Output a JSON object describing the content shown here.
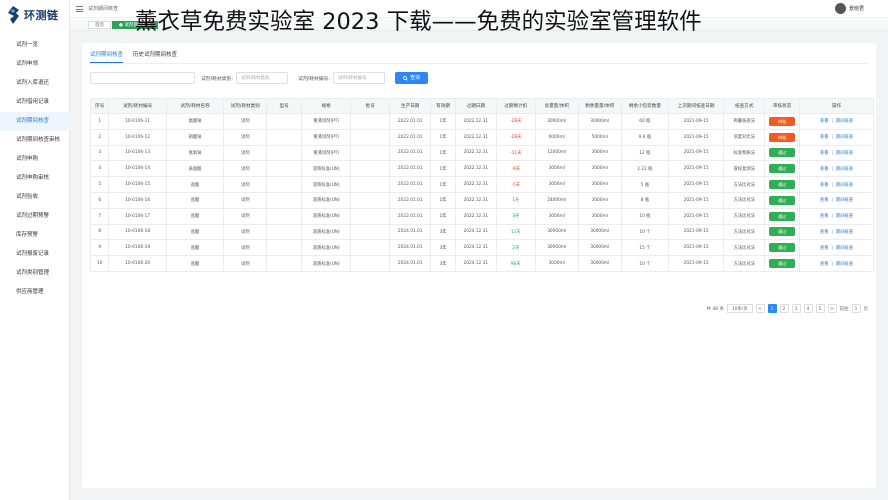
{
  "overlay_title": "薰衣草免费实验室 2023 下载——免费的实验室管理软件",
  "brand": {
    "name": "环测链"
  },
  "sidebar": {
    "items": [
      {
        "label": "试剂一览",
        "active": false
      },
      {
        "label": "试剂申领",
        "active": false
      },
      {
        "label": "试剂入库退还",
        "active": false
      },
      {
        "label": "试剂借用记录",
        "active": false
      },
      {
        "label": "试剂期间核查",
        "active": true
      },
      {
        "label": "试剂期间核查审核",
        "active": false
      },
      {
        "label": "试剂申购",
        "active": false
      },
      {
        "label": "试剂申购审核",
        "active": false
      },
      {
        "label": "试剂验收",
        "active": false
      },
      {
        "label": "试剂过期预警",
        "active": false
      },
      {
        "label": "库存预警",
        "active": false
      },
      {
        "label": "试剂报废记录",
        "active": false
      },
      {
        "label": "试剂类别管理",
        "active": false
      },
      {
        "label": "供应商管理",
        "active": false
      }
    ]
  },
  "topbar": {
    "breadcrumb": "试剂期间核查",
    "username": "景晓君"
  },
  "tagsbar": {
    "tags": [
      {
        "label": "首页",
        "active": false
      },
      {
        "label": "● 试剂期间核查",
        "active": true
      }
    ]
  },
  "tabs": [
    {
      "label": "试剂期间核查",
      "active": true
    },
    {
      "label": "历史试剂期间核查",
      "active": false
    }
  ],
  "filters": {
    "search_placeholder": "",
    "type_label": "试剂/耗材类别:",
    "type_placeholder": "试剂/耗材类别",
    "code_label": "试剂/耗材编号:",
    "code_placeholder": "试剂/耗材编号",
    "query_label": "查询"
  },
  "table": {
    "headers": [
      "序号",
      "试剂/耗材编号",
      "试剂/耗材名称",
      "试剂/耗材类别",
      "型号",
      "规格",
      "批号",
      "生产日期",
      "有效期",
      "过期日期",
      "过期剩计扣",
      "总量量/体积",
      "剩余量量/体积",
      "剩余小包装数量",
      "上次期间核查日期",
      "核查方式",
      "审核状态",
      "操作"
    ],
    "rows": [
      {
        "no": "1",
        "code": "10-0106-11",
        "name": "氨酸钠",
        "type": "试剂",
        "model": "",
        "spec": "重液试剂(PT)",
        "batch": "",
        "prod": "2022.01.01",
        "valid": "1年",
        "expire": "2022.12.31",
        "remain": "-28天",
        "remain_color": "red",
        "total": "30000ml",
        "left": "30000ml",
        "small": "60 瓶",
        "last": "2021-09-15",
        "method": "称量核查法",
        "status": "待批",
        "status_color": "red"
      },
      {
        "no": "2",
        "code": "10-0106-12",
        "name": "硝酸钠",
        "type": "试剂",
        "model": "",
        "spec": "重液试剂(PT)",
        "batch": "",
        "prod": "2022.01.01",
        "valid": "1年",
        "expire": "2022.12.31",
        "remain": "-28天",
        "remain_color": "red",
        "total": "6000ml",
        "left": "5000ml",
        "small": "9.6 瓶",
        "last": "2021-09-15",
        "method": "浓度对比法",
        "status": "待批",
        "status_color": "red"
      },
      {
        "no": "3",
        "code": "10-0106-13",
        "name": "氢氧钠",
        "type": "试剂",
        "model": "",
        "spec": "重液试剂(PT)",
        "batch": "",
        "prod": "2022.01.01",
        "valid": "1年",
        "expire": "2022.12.31",
        "remain": "-11天",
        "remain_color": "red",
        "total": "12000ml",
        "left": "3000ml",
        "small": "12 瓶",
        "last": "2021-09-15",
        "method": "标准物质法",
        "status": "通过",
        "status_color": "green"
      },
      {
        "no": "4",
        "code": "10-0106-14",
        "name": "表面酸",
        "type": "试剂",
        "model": "",
        "spec": "溶液标准(UN)",
        "batch": "",
        "prod": "2022.01.01",
        "valid": "1年",
        "expire": "2022.12.31",
        "remain": "-9天",
        "remain_color": "red",
        "total": "3000ml",
        "left": "3000ml",
        "small": "2.22 瓶",
        "last": "2021-09-15",
        "method": "冒样复测法",
        "status": "通过",
        "status_color": "green"
      },
      {
        "no": "5",
        "code": "10-0106-15",
        "name": "盐酸",
        "type": "试剂",
        "model": "",
        "spec": "溶液标准(UN)",
        "batch": "",
        "prod": "2022.01.01",
        "valid": "1年",
        "expire": "2022.12.31",
        "remain": "-5天",
        "remain_color": "red",
        "total": "3000ml",
        "left": "3000ml",
        "small": "5 瓶",
        "last": "2021-09-15",
        "method": "方法比对法",
        "status": "通过",
        "status_color": "green"
      },
      {
        "no": "6",
        "code": "10-0106-16",
        "name": "盐酸",
        "type": "试剂",
        "model": "",
        "spec": "溶液标准(UN)",
        "batch": "",
        "prod": "2022.01.01",
        "valid": "1年",
        "expire": "2022.12.31",
        "remain": "1天",
        "remain_color": "green",
        "total": "24000ml",
        "left": "3000ml",
        "small": "8 瓶",
        "last": "2021-09-15",
        "method": "方法比对法",
        "status": "通过",
        "status_color": "green"
      },
      {
        "no": "7",
        "code": "10-0106-17",
        "name": "盐酸",
        "type": "试剂",
        "model": "",
        "spec": "溶液标准(UN)",
        "batch": "",
        "prod": "2022.01.01",
        "valid": "1年",
        "expire": "2022.12.31",
        "remain": "3天",
        "remain_color": "green",
        "total": "3000ml",
        "left": "3000ml",
        "small": "10 瓶",
        "last": "2021-09-15",
        "method": "方法比对法",
        "status": "通过",
        "status_color": "green"
      },
      {
        "no": "8",
        "code": "10-0106-18",
        "name": "盐酸",
        "type": "试剂",
        "model": "",
        "spec": "溶液标准(UN)",
        "batch": "",
        "prod": "2024.01.01",
        "valid": "3年",
        "expire": "2024.12.31",
        "remain": "11天",
        "remain_color": "green",
        "total": "30000ml",
        "left": "30000ml",
        "small": "10 个",
        "last": "2021-09-15",
        "method": "方法比对法",
        "status": "通过",
        "status_color": "green"
      },
      {
        "no": "9",
        "code": "10-0106-19",
        "name": "盐酸",
        "type": "试剂",
        "model": "",
        "spec": "溶液标准(UN)",
        "batch": "",
        "prod": "2024.01.01",
        "valid": "3年",
        "expire": "2024.12.31",
        "remain": "2天",
        "remain_color": "green",
        "total": "30000ml",
        "left": "30000ml",
        "small": "15 个",
        "last": "2021-09-15",
        "method": "方法比对法",
        "status": "通过",
        "status_color": "green"
      },
      {
        "no": "10",
        "code": "10-0106-20",
        "name": "盐酸",
        "type": "试剂",
        "model": "",
        "spec": "溶液标准(UN)",
        "batch": "",
        "prod": "2024.01.01",
        "valid": "3年",
        "expire": "2024.12.31",
        "remain": "90天",
        "remain_color": "green",
        "total": "3000ml",
        "left": "30000ml",
        "small": "10 个",
        "last": "2021-09-15",
        "method": "方法比对法",
        "status": "通过",
        "status_color": "green"
      }
    ],
    "op_view": "查看",
    "op_check": "期间核查"
  },
  "pagination": {
    "total": "共 48 条",
    "page_size": "10条/页",
    "prev": "<",
    "next": ">",
    "pages": [
      "1",
      "2",
      "3",
      "4",
      "5"
    ],
    "current": "1",
    "goto_label": "前往",
    "goto_value": "1",
    "goto_suffix": "页"
  },
  "colors": {
    "accent": "#1e78d7",
    "danger": "#ef5b22",
    "success": "#2fae55",
    "brand_green": "#2f9e58"
  }
}
